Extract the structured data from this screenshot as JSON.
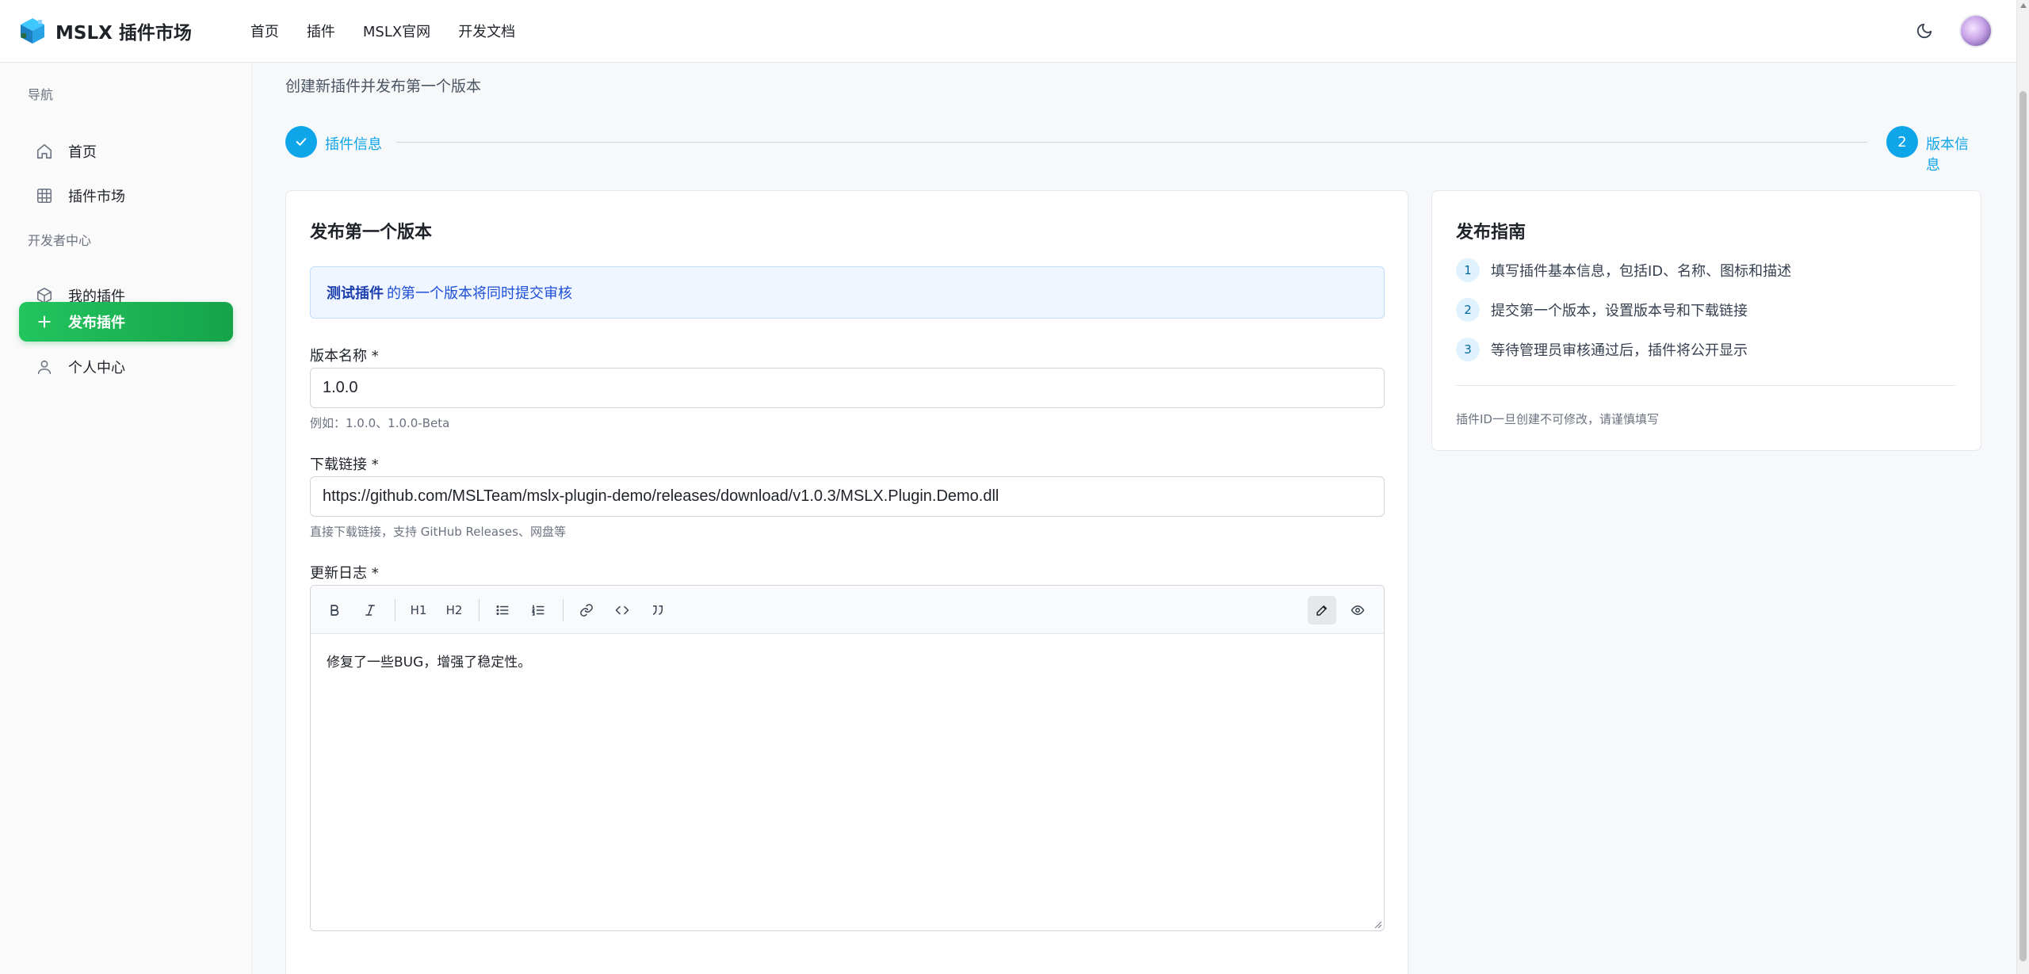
{
  "brand": {
    "title": "MSLX 插件市场"
  },
  "topnav": [
    {
      "label": "首页"
    },
    {
      "label": "插件"
    },
    {
      "label": "MSLX官网"
    },
    {
      "label": "开发文档"
    }
  ],
  "sidebar": {
    "section_nav": "导航",
    "section_dev": "开发者中心",
    "items": [
      {
        "label": "首页",
        "icon": "home-icon"
      },
      {
        "label": "插件市场",
        "icon": "grid-icon"
      },
      {
        "label": "我的插件",
        "icon": "package-icon"
      },
      {
        "label": "发布插件",
        "icon": "plus-icon",
        "active": true
      },
      {
        "label": "个人中心",
        "icon": "user-icon"
      }
    ]
  },
  "page": {
    "subtitle": "创建新插件并发布第一个版本"
  },
  "stepper": {
    "step1_label": "插件信息",
    "step2_number": "2",
    "step2_label": "版本信息"
  },
  "form": {
    "title": "发布第一个版本",
    "notice_name": "测试插件",
    "notice_text": "的第一个版本将同时提交审核",
    "version_label": "版本名称 *",
    "version_value": "1.0.0",
    "version_hint": "例如：1.0.0、1.0.0-Beta",
    "download_label": "下载链接 *",
    "download_value": "https://github.com/MSLTeam/mslx-plugin-demo/releases/download/v1.0.3/MSLX.Plugin.Demo.dll",
    "download_hint": "直接下载链接，支持 GitHub Releases、网盘等",
    "changelog_label": "更新日志 *",
    "changelog_value": "修复了一些BUG，增强了稳定性。",
    "toolbar": {
      "h1": "H1",
      "h2": "H2"
    }
  },
  "guide": {
    "title": "发布指南",
    "steps": [
      {
        "num": "1",
        "text": "填写插件基本信息，包括ID、名称、图标和描述"
      },
      {
        "num": "2",
        "text": "提交第一个版本，设置版本号和下载链接"
      },
      {
        "num": "3",
        "text": "等待管理员审核通过后，插件将公开显示"
      }
    ],
    "note": "插件ID一旦创建不可修改，请谨慎填写"
  },
  "colors": {
    "accent": "#0ea5e9",
    "active_green": "#16a34a"
  }
}
